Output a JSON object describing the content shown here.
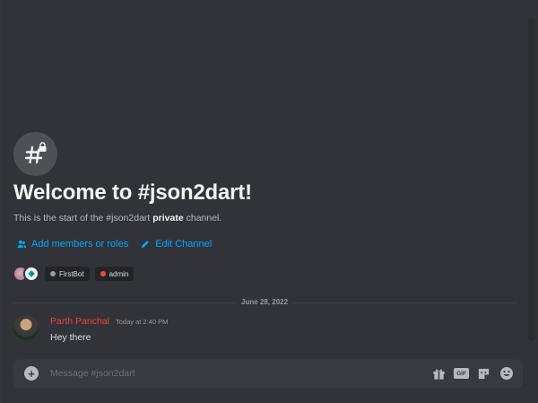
{
  "channel": {
    "name": "json2dart",
    "welcome_title": "Welcome to #json2dart!",
    "welcome_sub_prefix": "This is the start of the #json2dart ",
    "welcome_sub_bold": "private",
    "welcome_sub_suffix": " channel."
  },
  "actions": {
    "add_members_label": "Add members or roles",
    "edit_channel_label": "Edit Channel"
  },
  "roles": [
    {
      "name": "FirstBot",
      "color": "#949ba4"
    },
    {
      "name": "admin",
      "color": "#e74c3c"
    }
  ],
  "date_divider": "June 28, 2022",
  "message": {
    "author": "Parth Panchal",
    "author_color": "#f23f43",
    "timestamp": "Today at 2:40 PM",
    "text": "Hey there"
  },
  "composer": {
    "placeholder": "Message #json2dart",
    "gif_label": "GIF"
  },
  "icons": {
    "channel": "hash-lock-icon",
    "add_members": "members-icon",
    "edit": "pencil-icon",
    "attach": "plus-circle-icon",
    "gift": "gift-icon",
    "gif": "gif-icon",
    "sticker": "sticker-icon",
    "emoji": "emoji-icon"
  }
}
